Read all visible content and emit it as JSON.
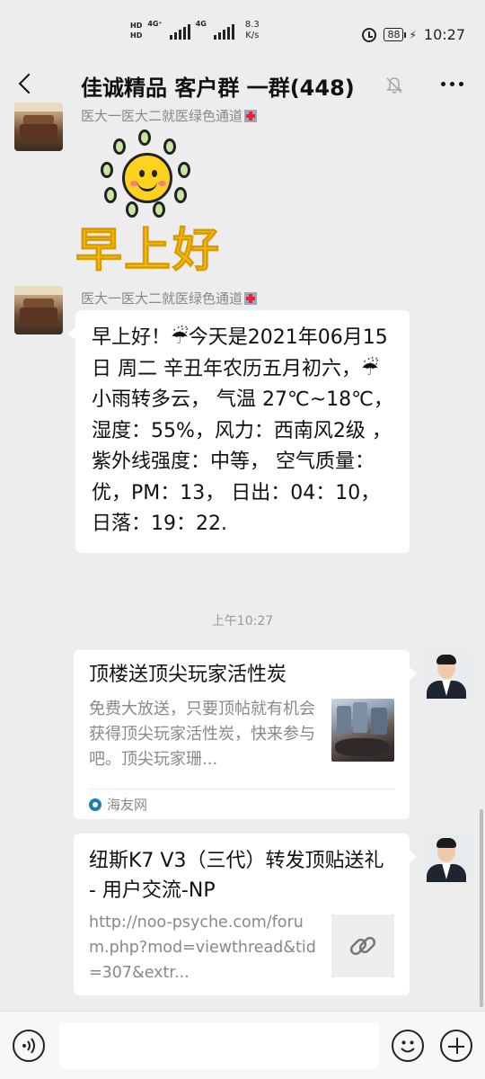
{
  "status_bar": {
    "network_badges": [
      "HD",
      "HD"
    ],
    "signal_labels": [
      "4G⁺",
      "4G"
    ],
    "speed_value": "8.3",
    "speed_unit": "K/s",
    "battery": "88",
    "time": "10:27"
  },
  "nav": {
    "title": "佳诚精品 客户群 一群(448)"
  },
  "messages": [
    {
      "sender": "医大一医大二就医绿色通道",
      "type": "sticker",
      "sticker_text": "早上好"
    },
    {
      "sender": "医大一医大二就医绿色通道",
      "type": "text",
      "text": "早上好！☔今天是2021年06月15日   周二  辛丑年农历五月初六，☔小雨转多云， 气温 27℃~18℃，湿度：55%，风力：西南风2级 ，紫外线强度：中等， 空气质量：优，PM：13， 日出：04：10，日落：19：22."
    }
  ],
  "timestamp": "上午10:27",
  "cards": [
    {
      "title": "顶楼送顶尖玩家活性炭",
      "description": "免费大放送，只要顶帖就有机会获得顶尖玩家活性炭，快来参与吧。顶尖玩家珊...",
      "source": "海友网"
    },
    {
      "title": "纽斯K7 V3（三代）转发顶贴送礼 - 用户交流-NP",
      "description": "http://noo-psyche.com/forum.php?mod=viewthread&tid=307&extr..."
    }
  ],
  "input": {
    "value": "",
    "placeholder": ""
  },
  "icons": {
    "back": "back-arrow-icon",
    "mute": "mute-bell-icon",
    "more": "more-icon",
    "voice": "voice-icon",
    "emoji": "emoji-icon",
    "plus": "plus-icon",
    "link": "link-icon"
  }
}
